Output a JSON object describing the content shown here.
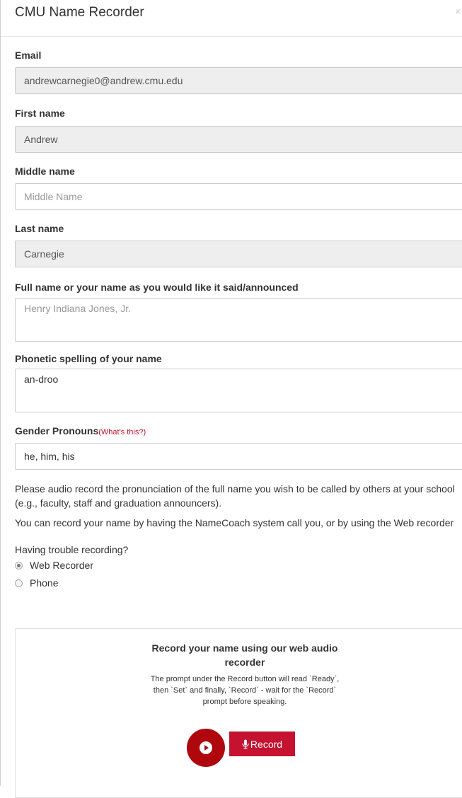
{
  "modal": {
    "title": "CMU Name Recorder",
    "close_glyph": "×"
  },
  "fields": {
    "email": {
      "label": "Email",
      "value": "andrewcarnegie0@andrew.cmu.edu"
    },
    "first_name": {
      "label": "First name",
      "value": "Andrew"
    },
    "middle_name": {
      "label": "Middle name",
      "placeholder": "Middle Name"
    },
    "last_name": {
      "label": "Last name",
      "value": "Carnegie"
    },
    "full_name": {
      "label": "Full name or your name as you would like it said/announced",
      "placeholder": "Henry Indiana Jones, Jr."
    },
    "phonetic": {
      "label": "Phonetic spelling of your name",
      "value": "an-droo"
    },
    "pronouns": {
      "label": "Gender Pronouns",
      "help_link": "(What's this?)",
      "value": "he, him, his"
    }
  },
  "instructions": {
    "para1": "Please audio record the pronunciation of the full name you wish to be called by others at your school (e.g., faculty, staff and graduation announcers).",
    "para2": "You can record your name by having the NameCoach system call you, or by using the Web recorder",
    "trouble_link": "Having trouble recording?"
  },
  "record_method": {
    "options": [
      {
        "label": "Web Recorder",
        "selected": true
      },
      {
        "label": "Phone",
        "selected": false
      }
    ]
  },
  "recorder": {
    "title": "Record your name using our web audio recorder",
    "description": "The prompt under the Record button will read `Ready`, then `Set` and finally, `Record` - wait for the `Record` prompt before speaking.",
    "record_label": "Record",
    "play_icon": "play-icon",
    "mic_icon": "microphone-icon"
  },
  "colors": {
    "accent": "#c41230",
    "play_button": "#b0070e",
    "readonly_bg": "#eeeeee"
  }
}
